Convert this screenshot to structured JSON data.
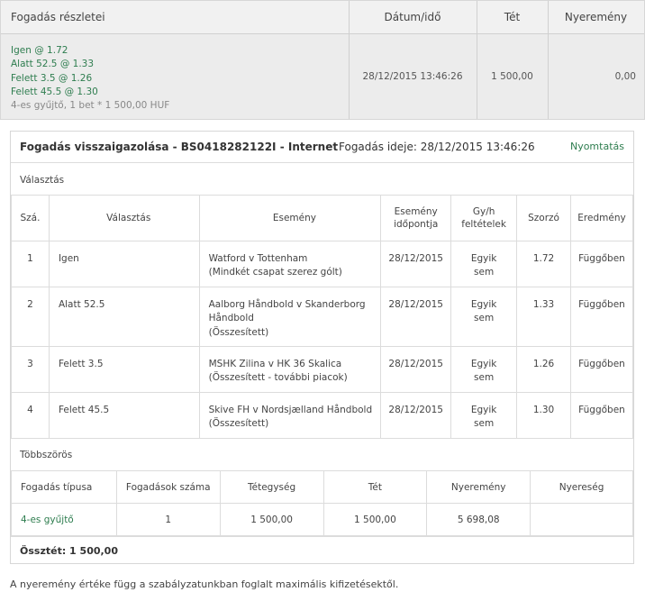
{
  "summary": {
    "headers": {
      "details": "Fogadás részletei",
      "datetime": "Dátum/idő",
      "stake": "Tét",
      "winnings": "Nyeremény"
    },
    "bet_lines": [
      "Igen @  1.72",
      "Alatt 52.5 @  1.33",
      "Felett 3.5 @  1.26",
      "Felett 45.5 @  1.30"
    ],
    "bet_info": "4-es gyűjtő, 1  bet * 1 500,00 HUF",
    "datetime": "28/12/2015 13:46:26",
    "stake": "1 500,00",
    "winnings": "0,00"
  },
  "confirmation": {
    "title": "Fogadás visszaigazolása  - BS0418282122I  - Internet",
    "placed_label": "Fogadás ideje:  28/12/2015 13:46:26",
    "print_label": "Nyomtatás",
    "selections_label": "Választás",
    "selection_headers": {
      "no": "Szá.",
      "selection": "Választás",
      "event": "Esemény",
      "event_time_1": "Esemény",
      "event_time_2": "időpontja",
      "terms_1": "Gy/h",
      "terms_2": "feltételek",
      "odds": "Szorzó",
      "result": "Eredmény"
    },
    "selections": [
      {
        "no": "1",
        "selection": "Igen",
        "event_1": "Watford v Tottenham",
        "event_2": "(Mindkét csapat szerez gólt)",
        "event_3": "",
        "date": "28/12/2015",
        "terms_1": "Egyik",
        "terms_2": "sem",
        "odds": "1.72",
        "result": "Függőben"
      },
      {
        "no": "2",
        "selection": "Alatt 52.5",
        "event_1": "Aalborg Håndbold v Skanderborg",
        "event_2": "Håndbold",
        "event_3": "(Összesített)",
        "date": "28/12/2015",
        "terms_1": "Egyik",
        "terms_2": "sem",
        "odds": "1.33",
        "result": "Függőben"
      },
      {
        "no": "3",
        "selection": "Felett 3.5",
        "event_1": "MSHK Zilina v HK 36 Skalica",
        "event_2": "(Összesített - további piacok)",
        "event_3": "",
        "date": "28/12/2015",
        "terms_1": "Egyik",
        "terms_2": "sem",
        "odds": "1.26",
        "result": "Függőben"
      },
      {
        "no": "4",
        "selection": "Felett 45.5",
        "event_1": "Skive FH v Nordsjælland Håndbold",
        "event_2": "(Összesített)",
        "event_3": "",
        "date": "28/12/2015",
        "terms_1": "Egyik",
        "terms_2": "sem",
        "odds": "1.30",
        "result": "Függőben"
      }
    ],
    "multiples_label": "Többszörös",
    "multiple_headers": {
      "type": "Fogadás típusa",
      "count": "Fogadások száma",
      "unit": "Tétegység",
      "stake": "Tét",
      "winnings": "Nyeremény",
      "profit": "Nyereség"
    },
    "multiple_row": {
      "type": "4-es gyűjtő",
      "count": "1",
      "unit": "1 500,00",
      "stake": "1 500,00",
      "winnings": "5 698,08",
      "profit": ""
    },
    "total_label": "Össztét:  1 500,00"
  },
  "footer_note": "A nyeremény értéke függ a szabályzatunkban foglalt maximális kifizetésektől.",
  "colors": {
    "accent_green": "#2e7d4f",
    "header_bg": "#ececec"
  }
}
